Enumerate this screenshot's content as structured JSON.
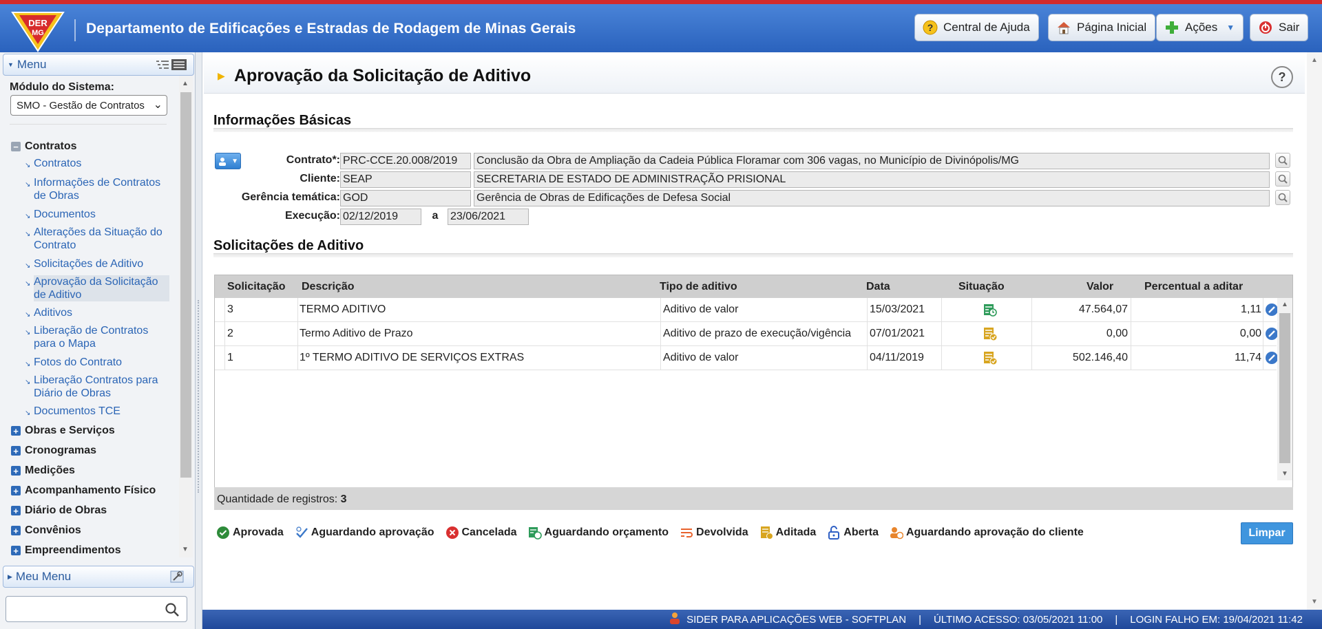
{
  "header": {
    "org_logo_text": "DER MG",
    "title": "Departamento de Edificações e Estradas de Rodagem de Minas Gerais",
    "buttons": {
      "help": "Central de Ajuda",
      "home": "Página Inicial",
      "actions": "Ações",
      "exit": "Sair"
    }
  },
  "sidebar": {
    "menu_title": "Menu",
    "module_label": "Módulo do Sistema:",
    "module_value": "SMO - Gestão de Contratos",
    "groups": [
      {
        "label": "Contratos",
        "expanded": true
      },
      {
        "label": "Obras e Serviços"
      },
      {
        "label": "Cronogramas"
      },
      {
        "label": "Medições"
      },
      {
        "label": "Acompanhamento Físico"
      },
      {
        "label": "Diário de Obras"
      },
      {
        "label": "Convênios"
      },
      {
        "label": "Empreendimentos"
      }
    ],
    "contract_items": [
      "Contratos",
      "Informações de Contratos de Obras",
      "Documentos",
      "Alterações da Situação do Contrato",
      "Solicitações de Aditivo",
      "Aprovação da Solicitação de Aditivo",
      "Aditivos",
      "Liberação de Contratos para o Mapa",
      "Fotos do Contrato",
      "Liberação Contratos para Diário de Obras",
      "Documentos TCE"
    ],
    "my_menu_title": "Meu Menu",
    "search_placeholder": ""
  },
  "main": {
    "page_title": "Aprovação da Solicitação de Aditivo",
    "help_symbol": "?",
    "basic_info": {
      "section_title": "Informações Básicas",
      "contract_label": "Contrato*:",
      "contract_code": "PRC-CCE.20.008/2019",
      "contract_desc": "Conclusão da Obra de Ampliação da Cadeia Pública Floramar com 306 vagas, no Município de Divinópolis/MG",
      "client_label": "Cliente:",
      "client_code": "SEAP",
      "client_name": "SECRETARIA DE ESTADO DE ADMINISTRAÇÃO PRISIONAL",
      "management_label": "Gerência temática:",
      "management_code": "GOD",
      "management_name": "Gerência de Obras de Edificações de Defesa Social",
      "execution_label": "Execução:",
      "execution_start": "02/12/2019",
      "execution_sep": "a",
      "execution_end": "23/06/2021"
    },
    "requests": {
      "section_title": "Solicitações de Aditivo",
      "columns": {
        "request": "Solicitação",
        "description": "Descrição",
        "type": "Tipo de aditivo",
        "date": "Data",
        "status": "Situação",
        "value": "Valor",
        "percent": "Percentual a aditar"
      },
      "rows": [
        {
          "request": "3",
          "description": "TERMO ADITIVO",
          "type": "Aditivo de valor",
          "date": "15/03/2021",
          "status_icon": "aguardando-orcamento-icon",
          "value": "47.564,07",
          "percent": "1,11"
        },
        {
          "request": "2",
          "description": "Termo Aditivo de Prazo",
          "type": "Aditivo de prazo de execução/vigência",
          "date": "07/01/2021",
          "status_icon": "aditada-icon",
          "value": "0,00",
          "percent": "0,00"
        },
        {
          "request": "1",
          "description": "1º TERMO ADITIVO DE SERVIÇOS EXTRAS",
          "type": "Aditivo de valor",
          "date": "04/11/2019",
          "status_icon": "aditada-icon",
          "value": "502.146,40",
          "percent": "11,74"
        }
      ],
      "count_label": "Quantidade de registros:",
      "count_value": "3"
    },
    "legend": [
      {
        "label": "Aprovada",
        "icon": "approved-check-icon",
        "color": "#2e8b3a"
      },
      {
        "label": "Aguardando aprovação",
        "icon": "pending-approval-icon",
        "color": "#3b78c9"
      },
      {
        "label": "Cancelada",
        "icon": "cancel-x-icon",
        "color": "#d93030"
      },
      {
        "label": "Aguardando orçamento",
        "icon": "budget-clock-icon",
        "color": "#2e9b5a"
      },
      {
        "label": "Devolvida",
        "icon": "returned-icon",
        "color": "#e8622c"
      },
      {
        "label": "Aditada",
        "icon": "document-check-icon",
        "color": "#d8a520"
      },
      {
        "label": "Aberta",
        "icon": "open-lock-icon",
        "color": "#2e5fc4"
      },
      {
        "label": "Aguardando aprovação do cliente",
        "icon": "client-approval-icon",
        "color": "#e8852c"
      }
    ],
    "clear_button": "Limpar"
  },
  "footer": {
    "system": "SIDER PARA APLICAÇÕES WEB - SOFTPLAN",
    "last_access": "ÚLTIMO ACESSO: 03/05/2021 11:00",
    "failed_login": "LOGIN FALHO EM: 19/04/2021 11:42",
    "separator": "|"
  }
}
